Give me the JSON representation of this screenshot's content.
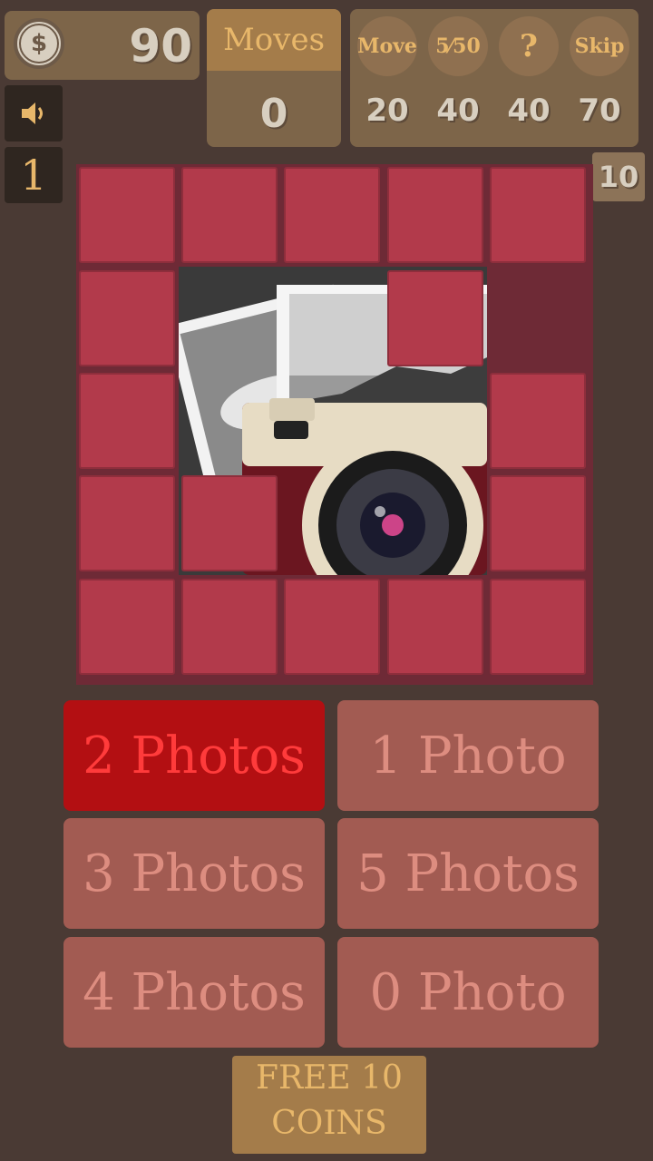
{
  "coins": {
    "icon": "dollar-coin-icon",
    "symbol": "$",
    "count": "90"
  },
  "moves": {
    "label": "Moves",
    "value": "0"
  },
  "hints": [
    {
      "label": "Move",
      "cost": "20"
    },
    {
      "label": "5⁄50",
      "cost": "40"
    },
    {
      "label": "?",
      "cost": "40"
    },
    {
      "label": "Skip",
      "cost": "70"
    }
  ],
  "sound": {
    "icon": "speaker-icon"
  },
  "level": "1",
  "tiles_remaining": "10",
  "answers": [
    {
      "label": "2 Photos",
      "selected": true
    },
    {
      "label": "1 Photo",
      "selected": false
    },
    {
      "label": "3 Photos",
      "selected": false
    },
    {
      "label": "5 Photos",
      "selected": false
    },
    {
      "label": "4 Photos",
      "selected": false
    },
    {
      "label": "0 Photo",
      "selected": false
    }
  ],
  "free_coins": {
    "line1": "FREE 10",
    "line2": "COINS"
  },
  "colors": {
    "background": "#4a3a34",
    "tile": "#b23a4b",
    "selected": "#b30f12",
    "accent": "#e8b76a"
  }
}
